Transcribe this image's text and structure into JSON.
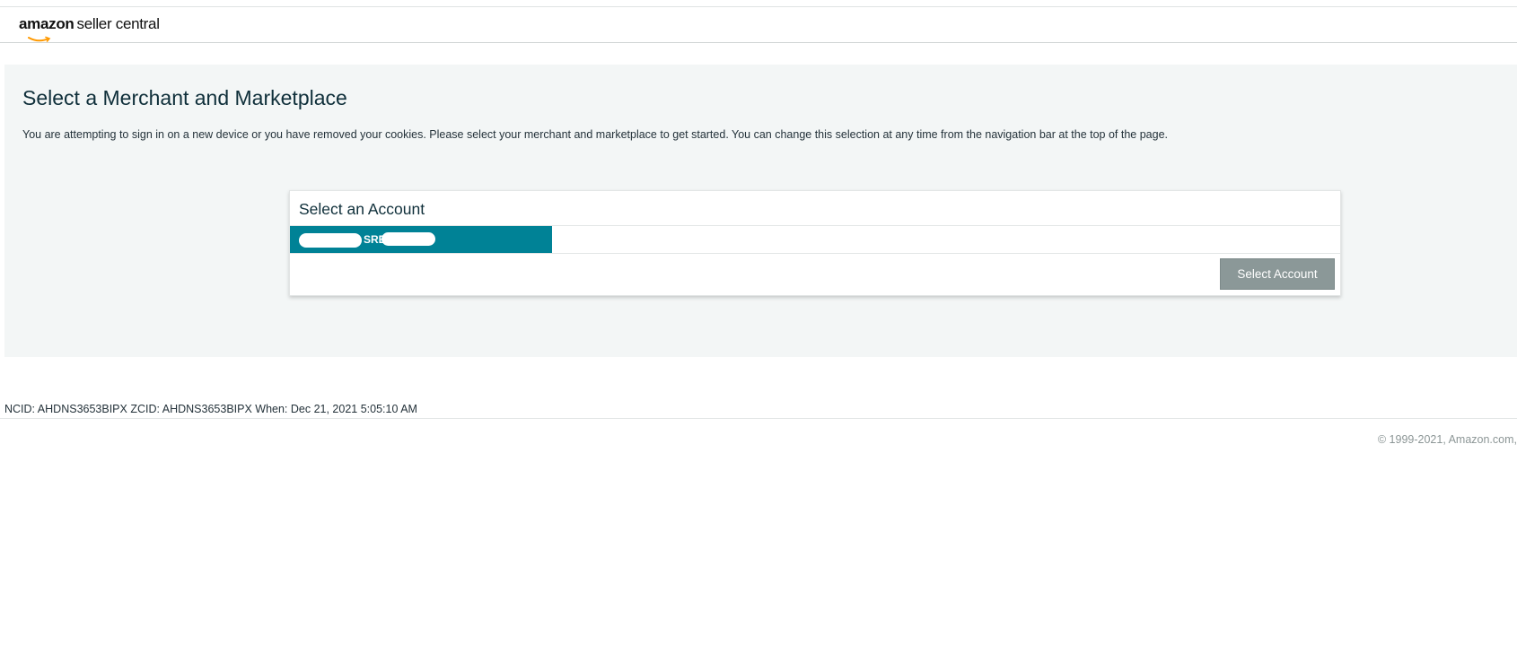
{
  "header": {
    "logo_brand": "amazon",
    "logo_product": "seller central"
  },
  "main": {
    "title": "Select a Merchant and Marketplace",
    "description": "You are attempting to sign in on a new device or you have removed your cookies. Please select your merchant and marketplace to get started. You can change this selection at any time from the navigation bar at the top of the page."
  },
  "account_card": {
    "title": "Select an Account",
    "accounts": [
      {
        "label": "SRE",
        "selected": true
      }
    ],
    "select_button": "Select Account"
  },
  "footer": {
    "info": "NCID: AHDNS3653BIPX ZCID: AHDNS3653BIPX When: Dec 21, 2021 5:05:10 AM",
    "copyright": "© 1999-2021, Amazon.com,"
  },
  "colors": {
    "accent_teal": "#008296",
    "button_disabled": "#8b9898",
    "panel_bg": "#f3f6f6",
    "logo_smile": "#ff9900"
  }
}
